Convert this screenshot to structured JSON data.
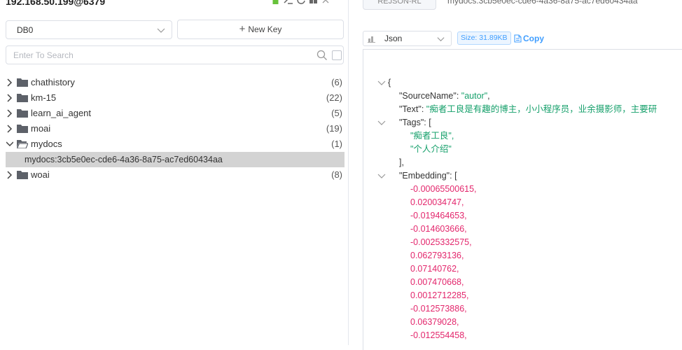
{
  "connection": {
    "name": "192.168.50.199@6379"
  },
  "toolbar": {
    "db_value": "DB0",
    "new_key_label": "New Key",
    "search_placeholder": "Enter To Search"
  },
  "tree": [
    {
      "label": "chathistory",
      "count": "(6)"
    },
    {
      "label": "km-15",
      "count": "(22)"
    },
    {
      "label": "learn_ai_agent",
      "count": "(5)"
    },
    {
      "label": "moai",
      "count": "(19)"
    },
    {
      "label": "mydocs",
      "count": "(1)",
      "expanded": true,
      "children": [
        "mydocs:3cb5e0ec-cde6-4a36-8a75-ac7ed60434aa"
      ]
    },
    {
      "label": "woai",
      "count": "(8)"
    }
  ],
  "detail": {
    "type_tab": "REJSON-RL",
    "key_name": "mydocs:3cb5e0ec-cde6-4a36-8a75-ac7ed60434aa",
    "format_value": "Json",
    "size_badge": "Size: 31.89KB",
    "copy_label": "Copy"
  },
  "json_view": {
    "open_brace": "{",
    "source_key": "\"SourceName\"",
    "source_value": "\"autor\"",
    "text_key": "\"Text\"",
    "text_value": "\"痴者工良是有趣的博主，小小程序员，业余摄影师，主要研",
    "tags_key": "\"Tags\"",
    "tags": [
      "\"痴者工良\",",
      "\"个人介绍\""
    ],
    "tags_close": "],",
    "embedding_key": "\"Embedding\"",
    "embedding": [
      "-0.00065500615,",
      "0.020034747,",
      "-0.019464653,",
      "-0.014603666,",
      "-0.0025332575,",
      "0.062793136,",
      "0.07140762,",
      "0.007470668,",
      "0.0012712285,",
      "-0.012573886,",
      "0.06379028,",
      "-0.012554458,"
    ]
  },
  "colors": {
    "string": "#16a06b",
    "number": "#e3266c",
    "accent": "#409eff",
    "selected_row": "#d3d3d3",
    "icon_green": "#67c23a"
  }
}
